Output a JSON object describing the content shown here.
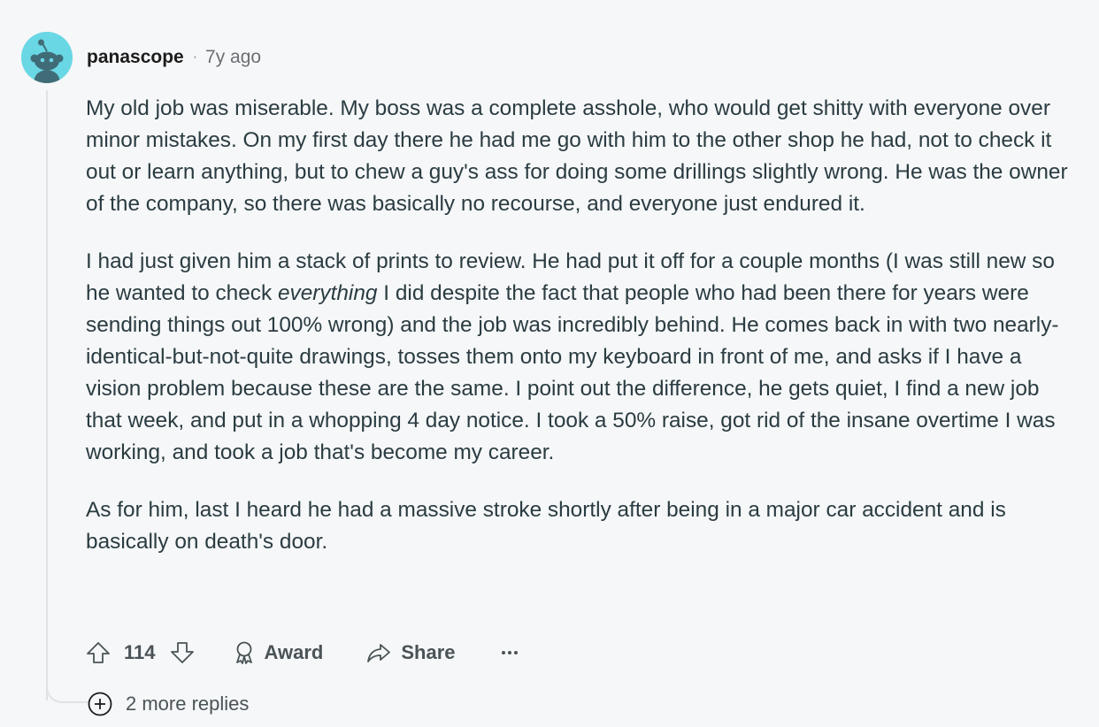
{
  "comment": {
    "author": "panascope",
    "separator": "·",
    "time": "7y ago",
    "avatar_color": "#6ad7e5",
    "body": {
      "p1": "My old job was miserable. My boss was a complete asshole, who would get shitty with everyone over minor mistakes. On my first day there he had me go with him to the other shop he had, not to check it out or learn anything, but to chew a guy's ass for doing some drillings slightly wrong. He was the owner of the company, so there was basically no recourse, and everyone just endured it.",
      "p2_before": "I had just given him a stack of prints to review. He had put it off for a couple months (I was still new so he wanted to check ",
      "p2_em": "everything",
      "p2_after": " I did despite the fact that people who had been there for years were sending things out 100% wrong) and the job was incredibly behind. He comes back in with two nearly-identical-but-not-quite drawings, tosses them onto my keyboard in front of me, and asks if I have a vision problem because these are the same. I point out the difference, he gets quiet, I find a new job that week, and put in a whopping 4 day notice. I took a 50% raise, got rid of the insane overtime I was working, and took a job that's become my career.",
      "p3": "As for him, last I heard he had a massive stroke shortly after being in a major car accident and is basically on death's door."
    },
    "actions": {
      "upvote_icon": "upvote-arrow-icon",
      "score": "114",
      "downvote_icon": "downvote-arrow-icon",
      "award_icon": "award-ribbon-icon",
      "award_label": "Award",
      "share_icon": "share-arrow-icon",
      "share_label": "Share",
      "overflow_icon": "ellipsis-icon"
    },
    "replies": {
      "icon": "plus-circle-icon",
      "label": "2 more replies"
    }
  },
  "colors": {
    "background": "#f6f7f8",
    "text": "#2a3c42",
    "muted": "#4a5357",
    "thread_line": "#e0e2e4"
  }
}
